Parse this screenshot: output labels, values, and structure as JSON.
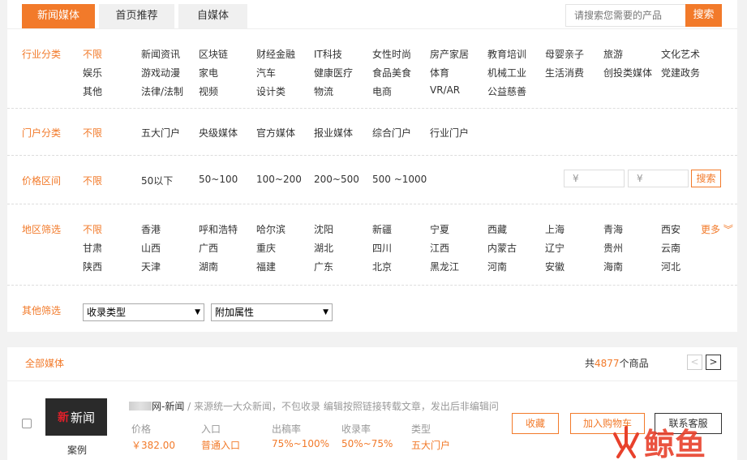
{
  "tabs": [
    {
      "label": "新闻媒体",
      "active": true
    },
    {
      "label": "首页推荐",
      "active": false
    },
    {
      "label": "自媒体",
      "active": false
    }
  ],
  "search": {
    "placeholder": "请搜索您需要的产品",
    "button": "搜索"
  },
  "filters": {
    "industry": {
      "label": "行业分类",
      "options": [
        [
          "不限",
          "新闻资讯",
          "区块链",
          "财经金融",
          "IT科技",
          "女性时尚",
          "房产家居",
          "教育培训",
          "母婴亲子",
          "旅游",
          "文化艺术"
        ],
        [
          "娱乐",
          "游戏动漫",
          "家电",
          "汽车",
          "健康医疗",
          "食品美食",
          "体育",
          "机械工业",
          "生活消费",
          "创投类媒体",
          "党建政务"
        ],
        [
          "其他",
          "法律/法制",
          "视频",
          "设计类",
          "物流",
          "电商",
          "VR/AR",
          "公益慈善"
        ]
      ]
    },
    "portal": {
      "label": "门户分类",
      "options": [
        "不限",
        "五大门户",
        "央级媒体",
        "官方媒体",
        "报业媒体",
        "综合门户",
        "行业门户"
      ]
    },
    "price": {
      "label": "价格区间",
      "options": [
        "不限",
        "50以下",
        "50~100",
        "100~200",
        "200~500",
        "500 ~1000"
      ],
      "min_placeholder": "¥",
      "max_placeholder": "¥",
      "button": "搜索"
    },
    "region": {
      "label": "地区筛选",
      "options": [
        [
          "不限",
          "香港",
          "呼和浩特",
          "哈尔滨",
          "沈阳",
          "新疆",
          "宁夏",
          "西藏",
          "上海",
          "青海",
          "西安"
        ],
        [
          "甘肃",
          "山西",
          "广西",
          "重庆",
          "湖北",
          "四川",
          "江西",
          "内蒙古",
          "辽宁",
          "贵州",
          "云南"
        ],
        [
          "陕西",
          "天津",
          "湖南",
          "福建",
          "广东",
          "北京",
          "黑龙江",
          "河南",
          "安徽",
          "海南",
          "河北"
        ]
      ],
      "more": "更多"
    },
    "other": {
      "label": "其他筛选",
      "select1": "收录类型",
      "select2": "附加属性"
    }
  },
  "list": {
    "all_label": "全部媒体",
    "count_prefix": "共",
    "count": "4877",
    "count_suffix": "个商品",
    "prev": "<",
    "next": ">"
  },
  "product": {
    "thumb_text_red": "新",
    "thumb_text": "新闻",
    "thumb_caption": "案例",
    "name": "网-新闻",
    "desc": " / 来源统一大众新闻，不包收录 编辑按照链接转载文章，发出后非编辑问",
    "meta": [
      {
        "label": "价格",
        "value": "￥382.00"
      },
      {
        "label": "入口",
        "value": "普通入口"
      },
      {
        "label": "出稿率",
        "value": "75%~100%"
      },
      {
        "label": "收录率",
        "value": "50%~75%"
      },
      {
        "label": "类型",
        "value": "五大门户"
      }
    ],
    "actions": {
      "favorite": "收藏",
      "cart": "加入购物车",
      "contact": "联系客服"
    }
  },
  "logo": {
    "text": "鲸鱼"
  },
  "colors": {
    "accent": "#f27a2a",
    "logo_red": "#e8412c"
  }
}
